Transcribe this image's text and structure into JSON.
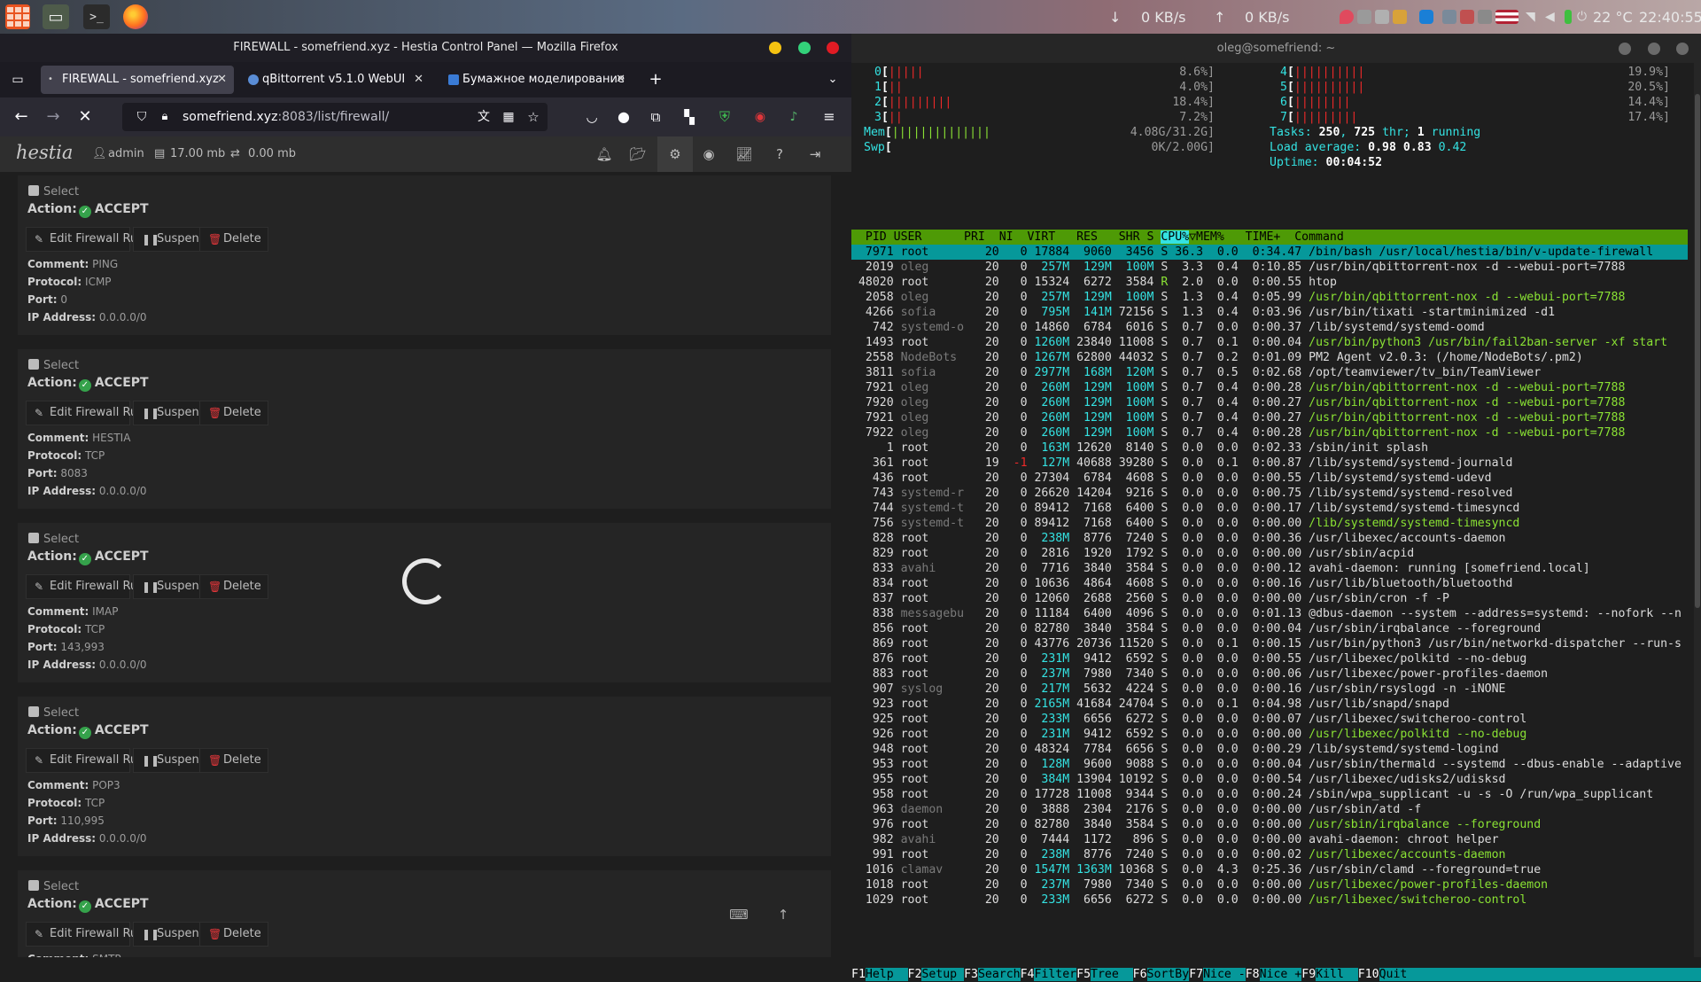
{
  "system_panel": {
    "net_down": "0 KB/s",
    "net_up": "0 KB/s",
    "weather": "22 °C",
    "clock": "22:40:55"
  },
  "firefox": {
    "window_title": "FIREWALL - somefriend.xyz - Hestia Control Panel — Mozilla Firefox",
    "tabs": [
      {
        "label": "FIREWALL - somefriend.xyz",
        "active": true
      },
      {
        "label": "qBittorrent v5.1.0 WebUI",
        "active": false
      },
      {
        "label": "Бумажное моделирование",
        "active": false
      }
    ],
    "url_host": "somefriend.xyz",
    "url_rest": ":8083/list/firewall/"
  },
  "hestia": {
    "logo": "hestia",
    "user": "admin",
    "disk": "17.00 mb",
    "bandwidth": "0.00 mb",
    "select_label": "Select",
    "action_label": "Action:",
    "edit_label": "Edit Firewall Rule",
    "suspend_label": "Suspend",
    "delete_label": "Delete",
    "comment_label": "Comment:",
    "protocol_label": "Protocol:",
    "port_label": "Port:",
    "ip_label": "IP Address:",
    "rules": [
      {
        "action": "ACCEPT",
        "comment": "PING",
        "protocol": "ICMP",
        "port": "0",
        "ip": "0.0.0.0/0"
      },
      {
        "action": "ACCEPT",
        "comment": "HESTIA",
        "protocol": "TCP",
        "port": "8083",
        "ip": "0.0.0.0/0"
      },
      {
        "action": "ACCEPT",
        "comment": "IMAP",
        "protocol": "TCP",
        "port": "143,993",
        "ip": "0.0.0.0/0"
      },
      {
        "action": "ACCEPT",
        "comment": "POP3",
        "protocol": "TCP",
        "port": "110,995",
        "ip": "0.0.0.0/0"
      },
      {
        "action": "ACCEPT",
        "comment": "SMTP",
        "protocol": "",
        "port": "",
        "ip": ""
      }
    ]
  },
  "terminal": {
    "title": "oleg@somefriend: ~",
    "cpus": [
      {
        "id": "0",
        "bar": "|||||",
        "pct": "8.6%"
      },
      {
        "id": "1",
        "bar": "||",
        "pct": "4.0%"
      },
      {
        "id": "2",
        "bar": "|||||||||",
        "pct": "18.4%"
      },
      {
        "id": "3",
        "bar": "||",
        "pct": "7.2%"
      },
      {
        "id": "4",
        "bar": "||||||||||",
        "pct": "19.9%"
      },
      {
        "id": "5",
        "bar": "||||||||||",
        "pct": "20.5%"
      },
      {
        "id": "6",
        "bar": "||||||||",
        "pct": "14.4%"
      },
      {
        "id": "7",
        "bar": "|||||||||",
        "pct": "17.4%"
      }
    ],
    "mem_bar": "||||||||||||||",
    "mem_value": "4.08G/31.2G",
    "swp_value": "0K/2.00G",
    "tasks_label": "Tasks:",
    "tasks": "250",
    "thr": "725",
    "thr_label": "thr;",
    "running": "1",
    "running_label": "running",
    "load_label": "Load average:",
    "load1": "0.98",
    "load5": "0.83",
    "load15": "0.42",
    "uptime_label": "Uptime:",
    "uptime": "00:04:52",
    "header": "  PID USER      PRI  NI  VIRT   RES   SHR S ",
    "header_sort": "CPU%",
    "header_rest": "▽MEM%   TIME+  Command",
    "processes": [
      {
        "pid": "7971",
        "user": "root",
        "pri": "20",
        "ni": "0",
        "virt": "17884",
        "res": "9060",
        "shr": "3456",
        "s": "S",
        "cpu": "36.3",
        "mem": "0.0",
        "time": "0:34.47",
        "cmd": "/bin/bash /usr/local/hestia/bin/v-update-firewall",
        "sel": true
      },
      {
        "pid": "2019",
        "user": "oleg",
        "pri": "20",
        "ni": "0",
        "virt": "257M",
        "res": "129M",
        "shr": "100M",
        "s": "S",
        "cpu": "3.3",
        "mem": "0.4",
        "time": "0:10.85",
        "cmd": "/usr/bin/qbittorrent-nox -d --webui-port=7788"
      },
      {
        "pid": "48020",
        "user": "root",
        "pri": "20",
        "ni": "0",
        "virt": "15324",
        "res": "6272",
        "shr": "3584",
        "s": "R",
        "cpu": "2.0",
        "mem": "0.0",
        "time": "0:00.55",
        "cmd": "htop"
      },
      {
        "pid": "2058",
        "user": "oleg",
        "pri": "20",
        "ni": "0",
        "virt": "257M",
        "res": "129M",
        "shr": "100M",
        "s": "S",
        "cpu": "1.3",
        "mem": "0.4",
        "time": "0:05.99",
        "cmd": "/usr/bin/qbittorrent-nox -d --webui-port=7788",
        "thread": true
      },
      {
        "pid": "4266",
        "user": "sofia",
        "pri": "20",
        "ni": "0",
        "virt": "795M",
        "res": "141M",
        "shr": "72156",
        "s": "S",
        "cpu": "1.3",
        "mem": "0.4",
        "time": "0:03.96",
        "cmd": "/usr/bin/tixati -startminimized -d1"
      },
      {
        "pid": "742",
        "user": "systemd-o",
        "pri": "20",
        "ni": "0",
        "virt": "14860",
        "res": "6784",
        "shr": "6016",
        "s": "S",
        "cpu": "0.7",
        "mem": "0.0",
        "time": "0:00.37",
        "cmd": "/lib/systemd/systemd-oomd"
      },
      {
        "pid": "1493",
        "user": "root",
        "pri": "20",
        "ni": "0",
        "virt": "1260M",
        "res": "23840",
        "shr": "11008",
        "s": "S",
        "cpu": "0.7",
        "mem": "0.1",
        "time": "0:00.04",
        "cmd": "/usr/bin/python3 /usr/bin/fail2ban-server -xf start",
        "thread": true
      },
      {
        "pid": "2558",
        "user": "NodeBots",
        "pri": "20",
        "ni": "0",
        "virt": "1267M",
        "res": "62800",
        "shr": "44032",
        "s": "S",
        "cpu": "0.7",
        "mem": "0.2",
        "time": "0:01.09",
        "cmd": "PM2 Agent v2.0.3: (/home/NodeBots/.pm2)"
      },
      {
        "pid": "3811",
        "user": "sofia",
        "pri": "20",
        "ni": "0",
        "virt": "2977M",
        "res": "168M",
        "shr": "120M",
        "s": "S",
        "cpu": "0.7",
        "mem": "0.5",
        "time": "0:02.68",
        "cmd": "/opt/teamviewer/tv_bin/TeamViewer"
      },
      {
        "pid": "7921",
        "user": "oleg",
        "pri": "20",
        "ni": "0",
        "virt": "260M",
        "res": "129M",
        "shr": "100M",
        "s": "S",
        "cpu": "0.7",
        "mem": "0.4",
        "time": "0:00.28",
        "cmd": "/usr/bin/qbittorrent-nox -d --webui-port=7788",
        "thread": true
      },
      {
        "pid": "7920",
        "user": "oleg",
        "pri": "20",
        "ni": "0",
        "virt": "260M",
        "res": "129M",
        "shr": "100M",
        "s": "S",
        "cpu": "0.7",
        "mem": "0.4",
        "time": "0:00.27",
        "cmd": "/usr/bin/qbittorrent-nox -d --webui-port=7788",
        "thread": true
      },
      {
        "pid": "7921",
        "user": "oleg",
        "pri": "20",
        "ni": "0",
        "virt": "260M",
        "res": "129M",
        "shr": "100M",
        "s": "S",
        "cpu": "0.7",
        "mem": "0.4",
        "time": "0:00.27",
        "cmd": "/usr/bin/qbittorrent-nox -d --webui-port=7788",
        "thread": true
      },
      {
        "pid": "7922",
        "user": "oleg",
        "pri": "20",
        "ni": "0",
        "virt": "260M",
        "res": "129M",
        "shr": "100M",
        "s": "S",
        "cpu": "0.7",
        "mem": "0.4",
        "time": "0:00.28",
        "cmd": "/usr/bin/qbittorrent-nox -d --webui-port=7788",
        "thread": true
      },
      {
        "pid": "1",
        "user": "root",
        "pri": "20",
        "ni": "0",
        "virt": "163M",
        "res": "12620",
        "shr": "8140",
        "s": "S",
        "cpu": "0.0",
        "mem": "0.0",
        "time": "0:02.33",
        "cmd": "/sbin/init splash"
      },
      {
        "pid": "361",
        "user": "root",
        "pri": "19",
        "ni": "-1",
        "virt": "127M",
        "res": "40688",
        "shr": "39280",
        "s": "S",
        "cpu": "0.0",
        "mem": "0.1",
        "time": "0:00.87",
        "cmd": "/lib/systemd/systemd-journald"
      },
      {
        "pid": "436",
        "user": "root",
        "pri": "20",
        "ni": "0",
        "virt": "27304",
        "res": "6784",
        "shr": "4608",
        "s": "S",
        "cpu": "0.0",
        "mem": "0.0",
        "time": "0:00.55",
        "cmd": "/lib/systemd/systemd-udevd"
      },
      {
        "pid": "743",
        "user": "systemd-r",
        "pri": "20",
        "ni": "0",
        "virt": "26620",
        "res": "14204",
        "shr": "9216",
        "s": "S",
        "cpu": "0.0",
        "mem": "0.0",
        "time": "0:00.75",
        "cmd": "/lib/systemd/systemd-resolved"
      },
      {
        "pid": "744",
        "user": "systemd-t",
        "pri": "20",
        "ni": "0",
        "virt": "89412",
        "res": "7168",
        "shr": "6400",
        "s": "S",
        "cpu": "0.0",
        "mem": "0.0",
        "time": "0:00.17",
        "cmd": "/lib/systemd/systemd-timesyncd"
      },
      {
        "pid": "756",
        "user": "systemd-t",
        "pri": "20",
        "ni": "0",
        "virt": "89412",
        "res": "7168",
        "shr": "6400",
        "s": "S",
        "cpu": "0.0",
        "mem": "0.0",
        "time": "0:00.00",
        "cmd": "/lib/systemd/systemd-timesyncd",
        "thread": true
      },
      {
        "pid": "828",
        "user": "root",
        "pri": "20",
        "ni": "0",
        "virt": "238M",
        "res": "8776",
        "shr": "7240",
        "s": "S",
        "cpu": "0.0",
        "mem": "0.0",
        "time": "0:00.36",
        "cmd": "/usr/libexec/accounts-daemon"
      },
      {
        "pid": "829",
        "user": "root",
        "pri": "20",
        "ni": "0",
        "virt": "2816",
        "res": "1920",
        "shr": "1792",
        "s": "S",
        "cpu": "0.0",
        "mem": "0.0",
        "time": "0:00.00",
        "cmd": "/usr/sbin/acpid"
      },
      {
        "pid": "833",
        "user": "avahi",
        "pri": "20",
        "ni": "0",
        "virt": "7716",
        "res": "3840",
        "shr": "3584",
        "s": "S",
        "cpu": "0.0",
        "mem": "0.0",
        "time": "0:00.12",
        "cmd": "avahi-daemon: running [somefriend.local]"
      },
      {
        "pid": "834",
        "user": "root",
        "pri": "20",
        "ni": "0",
        "virt": "10636",
        "res": "4864",
        "shr": "4608",
        "s": "S",
        "cpu": "0.0",
        "mem": "0.0",
        "time": "0:00.16",
        "cmd": "/usr/lib/bluetooth/bluetoothd"
      },
      {
        "pid": "837",
        "user": "root",
        "pri": "20",
        "ni": "0",
        "virt": "12060",
        "res": "2688",
        "shr": "2560",
        "s": "S",
        "cpu": "0.0",
        "mem": "0.0",
        "time": "0:00.00",
        "cmd": "/usr/sbin/cron -f -P"
      },
      {
        "pid": "838",
        "user": "messagebu",
        "pri": "20",
        "ni": "0",
        "virt": "11184",
        "res": "6400",
        "shr": "4096",
        "s": "S",
        "cpu": "0.0",
        "mem": "0.0",
        "time": "0:01.13",
        "cmd": "@dbus-daemon --system --address=systemd: --nofork --n"
      },
      {
        "pid": "856",
        "user": "root",
        "pri": "20",
        "ni": "0",
        "virt": "82780",
        "res": "3840",
        "shr": "3584",
        "s": "S",
        "cpu": "0.0",
        "mem": "0.0",
        "time": "0:00.04",
        "cmd": "/usr/sbin/irqbalance --foreground"
      },
      {
        "pid": "869",
        "user": "root",
        "pri": "20",
        "ni": "0",
        "virt": "43776",
        "res": "20736",
        "shr": "11520",
        "s": "S",
        "cpu": "0.0",
        "mem": "0.1",
        "time": "0:00.15",
        "cmd": "/usr/bin/python3 /usr/bin/networkd-dispatcher --run-s"
      },
      {
        "pid": "876",
        "user": "root",
        "pri": "20",
        "ni": "0",
        "virt": "231M",
        "res": "9412",
        "shr": "6592",
        "s": "S",
        "cpu": "0.0",
        "mem": "0.0",
        "time": "0:00.55",
        "cmd": "/usr/libexec/polkitd --no-debug"
      },
      {
        "pid": "883",
        "user": "root",
        "pri": "20",
        "ni": "0",
        "virt": "237M",
        "res": "7980",
        "shr": "7340",
        "s": "S",
        "cpu": "0.0",
        "mem": "0.0",
        "time": "0:00.06",
        "cmd": "/usr/libexec/power-profiles-daemon"
      },
      {
        "pid": "907",
        "user": "syslog",
        "pri": "20",
        "ni": "0",
        "virt": "217M",
        "res": "5632",
        "shr": "4224",
        "s": "S",
        "cpu": "0.0",
        "mem": "0.0",
        "time": "0:00.16",
        "cmd": "/usr/sbin/rsyslogd -n -iNONE"
      },
      {
        "pid": "923",
        "user": "root",
        "pri": "20",
        "ni": "0",
        "virt": "2165M",
        "res": "41684",
        "shr": "24704",
        "s": "S",
        "cpu": "0.0",
        "mem": "0.1",
        "time": "0:04.98",
        "cmd": "/usr/lib/snapd/snapd"
      },
      {
        "pid": "925",
        "user": "root",
        "pri": "20",
        "ni": "0",
        "virt": "233M",
        "res": "6656",
        "shr": "6272",
        "s": "S",
        "cpu": "0.0",
        "mem": "0.0",
        "time": "0:00.07",
        "cmd": "/usr/libexec/switcheroo-control"
      },
      {
        "pid": "926",
        "user": "root",
        "pri": "20",
        "ni": "0",
        "virt": "231M",
        "res": "9412",
        "shr": "6592",
        "s": "S",
        "cpu": "0.0",
        "mem": "0.0",
        "time": "0:00.00",
        "cmd": "/usr/libexec/polkitd --no-debug",
        "thread": true
      },
      {
        "pid": "948",
        "user": "root",
        "pri": "20",
        "ni": "0",
        "virt": "48324",
        "res": "7784",
        "shr": "6656",
        "s": "S",
        "cpu": "0.0",
        "mem": "0.0",
        "time": "0:00.29",
        "cmd": "/lib/systemd/systemd-logind"
      },
      {
        "pid": "953",
        "user": "root",
        "pri": "20",
        "ni": "0",
        "virt": "128M",
        "res": "9600",
        "shr": "9088",
        "s": "S",
        "cpu": "0.0",
        "mem": "0.0",
        "time": "0:00.04",
        "cmd": "/usr/sbin/thermald --systemd --dbus-enable --adaptive"
      },
      {
        "pid": "955",
        "user": "root",
        "pri": "20",
        "ni": "0",
        "virt": "384M",
        "res": "13904",
        "shr": "10192",
        "s": "S",
        "cpu": "0.0",
        "mem": "0.0",
        "time": "0:00.54",
        "cmd": "/usr/libexec/udisks2/udisksd"
      },
      {
        "pid": "958",
        "user": "root",
        "pri": "20",
        "ni": "0",
        "virt": "17728",
        "res": "11008",
        "shr": "9344",
        "s": "S",
        "cpu": "0.0",
        "mem": "0.0",
        "time": "0:00.24",
        "cmd": "/sbin/wpa_supplicant -u -s -O /run/wpa_supplicant"
      },
      {
        "pid": "963",
        "user": "daemon",
        "pri": "20",
        "ni": "0",
        "virt": "3888",
        "res": "2304",
        "shr": "2176",
        "s": "S",
        "cpu": "0.0",
        "mem": "0.0",
        "time": "0:00.00",
        "cmd": "/usr/sbin/atd -f"
      },
      {
        "pid": "976",
        "user": "root",
        "pri": "20",
        "ni": "0",
        "virt": "82780",
        "res": "3840",
        "shr": "3584",
        "s": "S",
        "cpu": "0.0",
        "mem": "0.0",
        "time": "0:00.00",
        "cmd": "/usr/sbin/irqbalance --foreground",
        "thread": true
      },
      {
        "pid": "982",
        "user": "avahi",
        "pri": "20",
        "ni": "0",
        "virt": "7444",
        "res": "1172",
        "shr": "896",
        "s": "S",
        "cpu": "0.0",
        "mem": "0.0",
        "time": "0:00.00",
        "cmd": "avahi-daemon: chroot helper"
      },
      {
        "pid": "991",
        "user": "root",
        "pri": "20",
        "ni": "0",
        "virt": "238M",
        "res": "8776",
        "shr": "7240",
        "s": "S",
        "cpu": "0.0",
        "mem": "0.0",
        "time": "0:00.02",
        "cmd": "/usr/libexec/accounts-daemon",
        "thread": true
      },
      {
        "pid": "1016",
        "user": "clamav",
        "pri": "20",
        "ni": "0",
        "virt": "1547M",
        "res": "1363M",
        "shr": "10368",
        "s": "S",
        "cpu": "0.0",
        "mem": "4.3",
        "time": "0:25.36",
        "cmd": "/usr/sbin/clamd --foreground=true"
      },
      {
        "pid": "1018",
        "user": "root",
        "pri": "20",
        "ni": "0",
        "virt": "237M",
        "res": "7980",
        "shr": "7340",
        "s": "S",
        "cpu": "0.0",
        "mem": "0.0",
        "time": "0:00.00",
        "cmd": "/usr/libexec/power-profiles-daemon",
        "thread": true
      },
      {
        "pid": "1029",
        "user": "root",
        "pri": "20",
        "ni": "0",
        "virt": "233M",
        "res": "6656",
        "shr": "6272",
        "s": "S",
        "cpu": "0.0",
        "mem": "0.0",
        "time": "0:00.00",
        "cmd": "/usr/libexec/switcheroo-control",
        "thread": true
      }
    ],
    "fkeys": [
      {
        "key": "F1",
        "label": "Help  "
      },
      {
        "key": "F2",
        "label": "Setup "
      },
      {
        "key": "F3",
        "label": "Search"
      },
      {
        "key": "F4",
        "label": "Filter"
      },
      {
        "key": "F5",
        "label": "Tree  "
      },
      {
        "key": "F6",
        "label": "SortBy"
      },
      {
        "key": "F7",
        "label": "Nice -"
      },
      {
        "key": "F8",
        "label": "Nice +"
      },
      {
        "key": "F9",
        "label": "Kill  "
      },
      {
        "key": "F10",
        "label": "Quit  "
      }
    ]
  }
}
